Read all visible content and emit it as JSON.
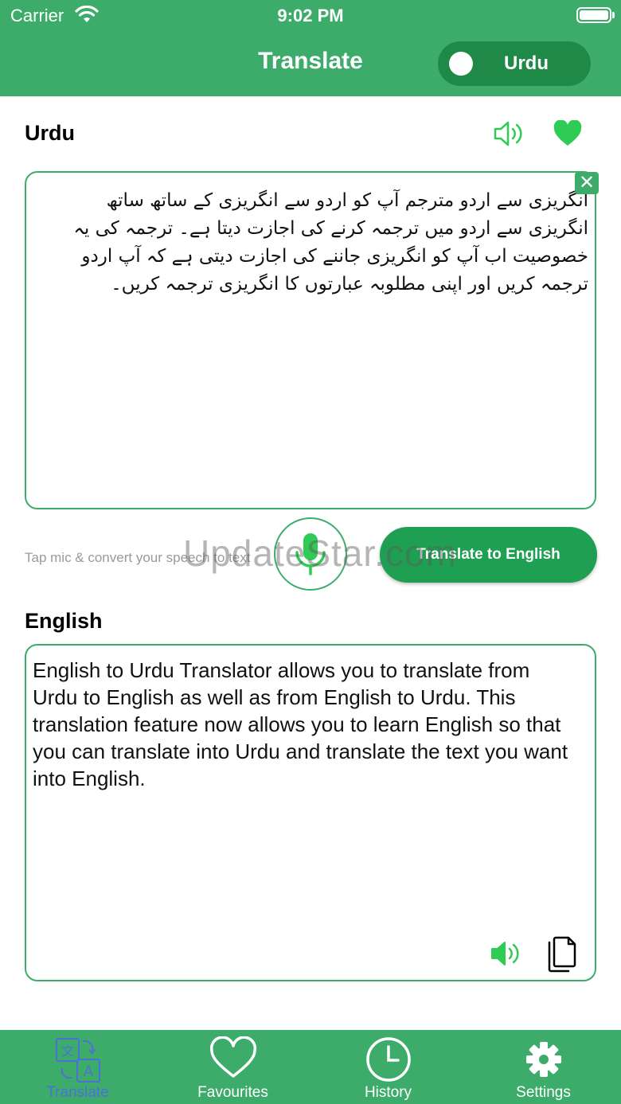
{
  "status_bar": {
    "carrier": "Carrier",
    "time": "9:02 PM"
  },
  "header": {
    "title": "Translate",
    "language_toggle": {
      "label": "Urdu",
      "on": false
    }
  },
  "source": {
    "label": "Urdu",
    "text": "انگریزی سے اردو مترجم آپ کو اردو سے انگریزی کے ساتھ ساتھ انگریزی سے اردو میں ترجمہ کرنے کی اجازت دیتا ہے۔  ترجمہ کی یہ خصوصیت اب آپ کو انگریزی جاننے کی اجازت دیتی ہے کہ آپ اردو ترجمہ کریں اور اپنی مطلوبہ عبارتوں کا انگریزی ترجمہ کریں۔",
    "clear_label": "✕"
  },
  "mic_hint": "Tap mic & convert your speech to text",
  "translate_button": "Translate to English",
  "watermark": "UpdateStar.com",
  "target": {
    "label": "English",
    "text": " English to Urdu Translator allows you to translate from Urdu to English as well as from English to Urdu. This translation feature now allows you to learn English so that you can translate into Urdu and translate the text you want into English."
  },
  "tabs": [
    {
      "label": "Translate",
      "icon": "translate-icon",
      "active": true
    },
    {
      "label": "Favourites",
      "icon": "heart-icon",
      "active": false
    },
    {
      "label": "History",
      "icon": "clock-icon",
      "active": false
    },
    {
      "label": "Settings",
      "icon": "gear-icon",
      "active": false
    }
  ],
  "colors": {
    "primary": "#3dac6b",
    "primary_dark": "#1f9f52",
    "active_tab": "#4f6fd8",
    "accent_icon": "#2ecc55"
  }
}
